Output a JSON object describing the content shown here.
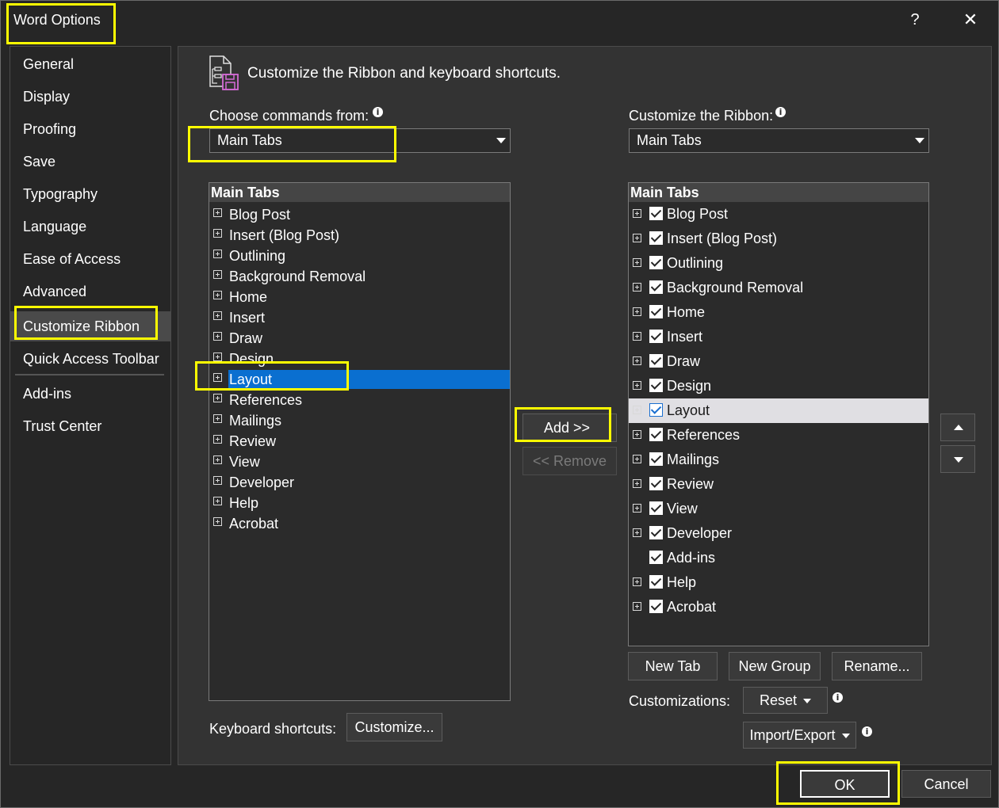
{
  "window": {
    "title": "Word Options",
    "help_label": "?",
    "close_label": "✕"
  },
  "nav": [
    {
      "label": "General"
    },
    {
      "label": "Display"
    },
    {
      "label": "Proofing"
    },
    {
      "label": "Save"
    },
    {
      "label": "Typography"
    },
    {
      "label": "Language"
    },
    {
      "label": "Ease of Access"
    },
    {
      "label": "Advanced"
    },
    {
      "label": "Customize Ribbon",
      "selected": true
    },
    {
      "label": "Quick Access Toolbar"
    },
    {
      "label": "Add-ins"
    },
    {
      "label": "Trust Center"
    }
  ],
  "header": {
    "title": "Customize the Ribbon and keyboard shortcuts.",
    "icon": "customize-ribbon-icon"
  },
  "left": {
    "choose_label": "Choose commands from:",
    "combo_value": "Main Tabs",
    "list_header": "Main Tabs",
    "items": [
      "Blog Post",
      "Insert (Blog Post)",
      "Outlining",
      "Background Removal",
      "Home",
      "Insert",
      "Draw",
      "Design",
      "Layout",
      "References",
      "Mailings",
      "Review",
      "View",
      "Developer",
      "Help",
      "Acrobat"
    ],
    "selected": "Layout"
  },
  "middle": {
    "add_label": "Add >>",
    "remove_label": "<< Remove"
  },
  "right": {
    "customize_label": "Customize the Ribbon:",
    "combo_value": "Main Tabs",
    "list_header": "Main Tabs",
    "items": [
      {
        "label": "Blog Post",
        "expand": true,
        "checked": true
      },
      {
        "label": "Insert (Blog Post)",
        "expand": true,
        "checked": true
      },
      {
        "label": "Outlining",
        "expand": true,
        "checked": true
      },
      {
        "label": "Background Removal",
        "expand": true,
        "checked": true
      },
      {
        "label": "Home",
        "expand": true,
        "checked": true
      },
      {
        "label": "Insert",
        "expand": true,
        "checked": true
      },
      {
        "label": "Draw",
        "expand": true,
        "checked": true
      },
      {
        "label": "Design",
        "expand": true,
        "checked": true
      },
      {
        "label": "Layout",
        "expand": true,
        "checked": true,
        "selected": true
      },
      {
        "label": "References",
        "expand": true,
        "checked": true
      },
      {
        "label": "Mailings",
        "expand": true,
        "checked": true
      },
      {
        "label": "Review",
        "expand": true,
        "checked": true
      },
      {
        "label": "View",
        "expand": true,
        "checked": true
      },
      {
        "label": "Developer",
        "expand": true,
        "checked": true
      },
      {
        "label": "Add-ins",
        "expand": false,
        "checked": true
      },
      {
        "label": "Help",
        "expand": true,
        "checked": true
      },
      {
        "label": "Acrobat",
        "expand": true,
        "checked": true
      }
    ]
  },
  "buttons": {
    "new_tab": "New Tab",
    "new_group": "New Group",
    "rename": "Rename...",
    "customizations_label": "Customizations:",
    "reset": "Reset",
    "import_export": "Import/Export",
    "keyboard_label": "Keyboard shortcuts:",
    "customize": "Customize...",
    "ok": "OK",
    "cancel": "Cancel"
  },
  "colors": {
    "highlight": "#ffff00",
    "selection_blue": "#0a6fd0",
    "selection_gray": "#e0dfe3"
  }
}
